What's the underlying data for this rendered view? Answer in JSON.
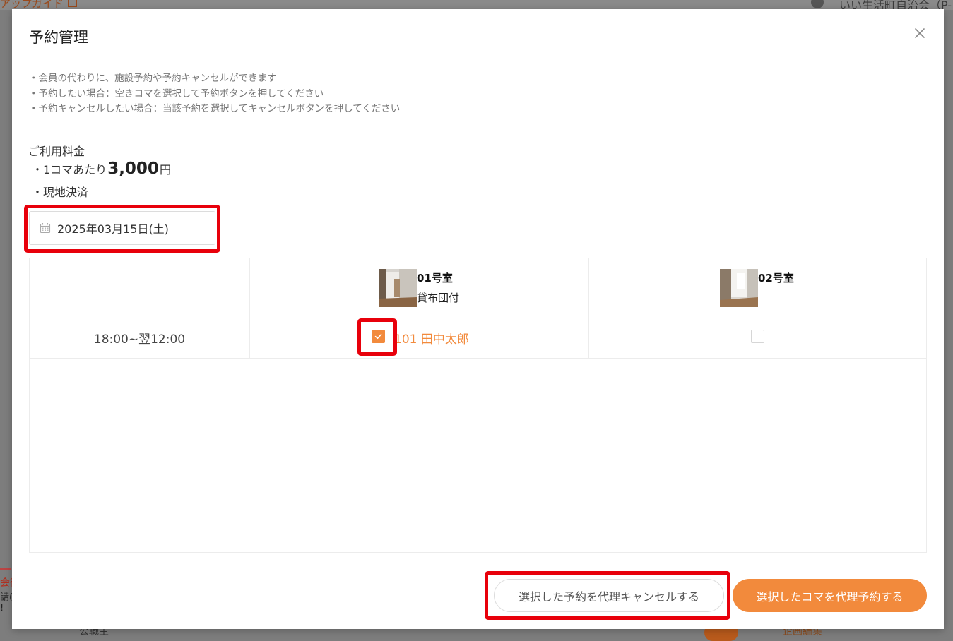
{
  "background": {
    "guide_link": "アップガイド",
    "user_name": "いい生活町自治会（P-",
    "side_text_1": "会待",
    "side_text_2": "請(",
    "side_text_3": "!",
    "bottom_text": "公職主",
    "bottom_link": "企画編集"
  },
  "modal": {
    "title": "予約管理",
    "notes": [
      "・会員の代わりに、施設予約や予約キャンセルができます",
      "・予約したい場合：空きコマを選択して予約ボタンを押してください",
      "・予約キャンセルしたい場合：当該予約を選択してキャンセルボタンを押してください"
    ],
    "fee": {
      "title": "ご利用料金",
      "per_slot_label": "・1コマあたり",
      "amount": "3,000",
      "unit": "円",
      "payment": "・現地決済"
    },
    "date": "2025年03月15日(土)",
    "rooms": [
      {
        "name": "01号室",
        "subtitle": "貸布団付"
      },
      {
        "name": "02号室",
        "subtitle": ""
      }
    ],
    "slots": [
      {
        "time": "18:00~翌12:00",
        "room1_reservation": "101 田中太郎",
        "room1_checked": true,
        "room2_checked": false
      }
    ],
    "buttons": {
      "cancel": "選択した予約を代理キャンセルする",
      "reserve": "選択したコマを代理予約する"
    }
  },
  "colors": {
    "accent": "#f28a3c",
    "highlight": "#e8000b"
  }
}
